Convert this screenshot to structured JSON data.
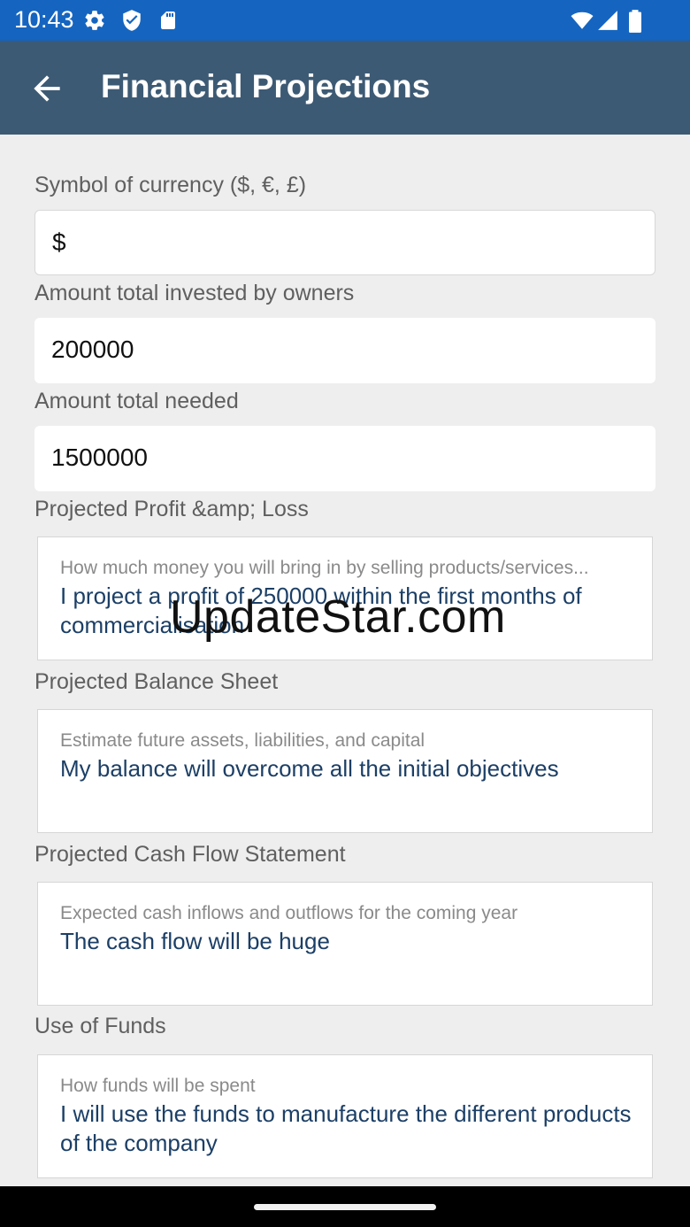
{
  "status_bar": {
    "time": "10:43",
    "icons": [
      "gear-icon",
      "shield-icon",
      "sd-card-icon",
      "wifi-icon",
      "signal-icon",
      "battery-icon"
    ]
  },
  "app_bar": {
    "title": "Financial Projections",
    "back_icon": "arrow-left-icon",
    "background": "#3d5a74"
  },
  "fields": {
    "currency": {
      "label": "Symbol of currency ($, €, £)",
      "value": "$"
    },
    "invested": {
      "label": "Amount total invested by owners",
      "value": "200000"
    },
    "needed": {
      "label": "Amount total needed",
      "value": "1500000"
    }
  },
  "sections": {
    "profit_loss": {
      "label": "Projected Profit &amp; Loss",
      "placeholder": "How much money you will bring in by selling products/services...",
      "value": "I project a profit of 250000 within the first months of commercialisation"
    },
    "balance_sheet": {
      "label": "Projected Balance Sheet",
      "placeholder": "Estimate future assets, liabilities, and capital",
      "value": "My balance will overcome all the initial objectives"
    },
    "cash_flow": {
      "label": "Projected Cash Flow Statement",
      "placeholder": "Expected cash inflows and outflows for the coming year",
      "value": "The cash flow will be huge"
    },
    "use_of_funds": {
      "label": "Use of Funds",
      "placeholder": "How funds will be spent",
      "value": "I will use the funds to manufacture the different products of the company"
    }
  },
  "watermark": "UpdateStar.com",
  "colors": {
    "status_bar": "#1565c0",
    "app_bar": "#3d5a74",
    "value_text": "#1c3f66",
    "background": "#eeeeee"
  }
}
